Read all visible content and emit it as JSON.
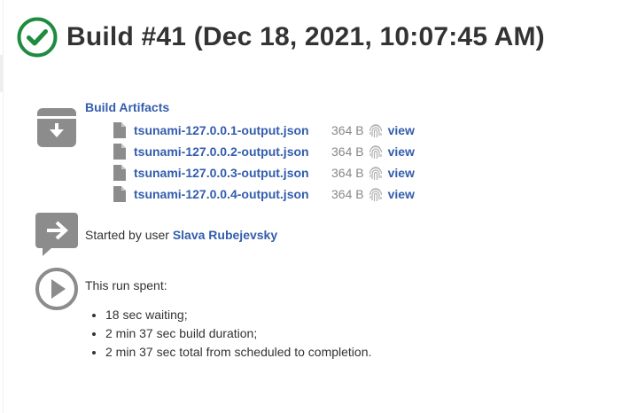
{
  "header": {
    "title": "Build #41 (Dec 18, 2021, 10:07:45 AM)",
    "status": "success",
    "status_color": "#1f8b3e",
    "status_icon": "check-circle-icon"
  },
  "artifacts": {
    "title": "Build Artifacts",
    "section_icon": "archive-download-icon",
    "items": [
      {
        "name": "tsunami-127.0.0.1-output.json",
        "size": "364 B",
        "view": "view"
      },
      {
        "name": "tsunami-127.0.0.2-output.json",
        "size": "364 B",
        "view": "view"
      },
      {
        "name": "tsunami-127.0.0.3-output.json",
        "size": "364 B",
        "view": "view"
      },
      {
        "name": "tsunami-127.0.0.4-output.json",
        "size": "364 B",
        "view": "view"
      }
    ]
  },
  "cause": {
    "prefix": "Started by user ",
    "user": "Slava Rubejevsky",
    "icon": "speech-arrow-icon"
  },
  "timing": {
    "title": "This run spent:",
    "icon": "play-circle-icon",
    "items": [
      "18 sec waiting;",
      "2 min 37 sec build duration;",
      "2 min 37 sec total from scheduled to completion."
    ]
  },
  "colors": {
    "link": "#335dad",
    "icon_gray": "#8c8c8c",
    "text": "#333333"
  }
}
